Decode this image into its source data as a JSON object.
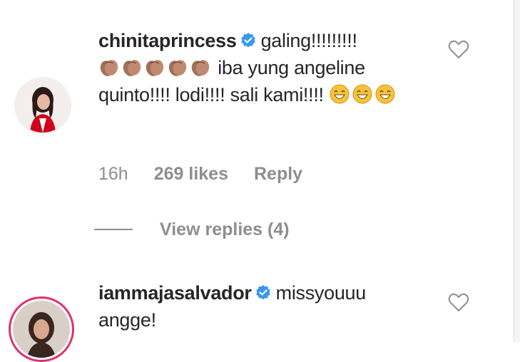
{
  "comments": [
    {
      "username": "chinitaprincess",
      "verified": true,
      "text_part1": "galing!!!!!!!!!",
      "text_part2": "iba yung angeline quinto!!!! lodi!!!! sali kami!!!!",
      "emoji_clap": "clapping-hands-emoji",
      "emoji_grin": "grinning-face-emoji",
      "time": "16h",
      "likes": "269 likes",
      "reply_label": "Reply",
      "view_replies": "View replies (4)"
    },
    {
      "username": "iammajasalvador",
      "verified": true,
      "text": "missyouuu angge!"
    }
  ],
  "colors": {
    "verified_blue": "#3897f0",
    "meta_gray": "#8e8e8e",
    "text": "#262626",
    "story_ring": "#e1306c"
  }
}
